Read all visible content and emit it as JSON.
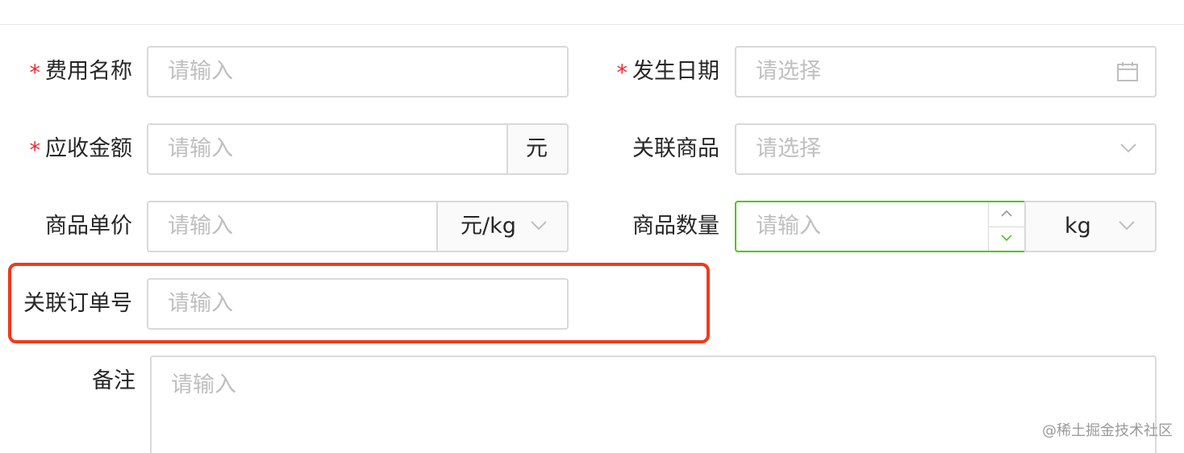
{
  "form": {
    "fee_name": {
      "label": "费用名称",
      "required_mark": "*",
      "placeholder": "请输入"
    },
    "occur_date": {
      "label": "发生日期",
      "required_mark": "*",
      "placeholder": "请选择",
      "icon": "calendar-icon"
    },
    "receivable_amount": {
      "label": "应收金额",
      "required_mark": "*",
      "placeholder": "请输入",
      "addon": "元"
    },
    "related_goods": {
      "label": "关联商品",
      "placeholder": "请选择",
      "icon": "chevron-down-icon"
    },
    "unit_price": {
      "label": "商品单价",
      "placeholder": "请输入",
      "unit_select": "元/kg"
    },
    "quantity": {
      "label": "商品数量",
      "placeholder": "请输入",
      "unit_select": "kg",
      "focused_border_color": "#52c41a"
    },
    "order_no": {
      "label": "关联订单号",
      "placeholder": "请输入",
      "highlight_color": "#f2391b"
    },
    "remark": {
      "label": "备注",
      "placeholder": "请输入"
    }
  },
  "watermark": "@稀土掘金技术社区"
}
